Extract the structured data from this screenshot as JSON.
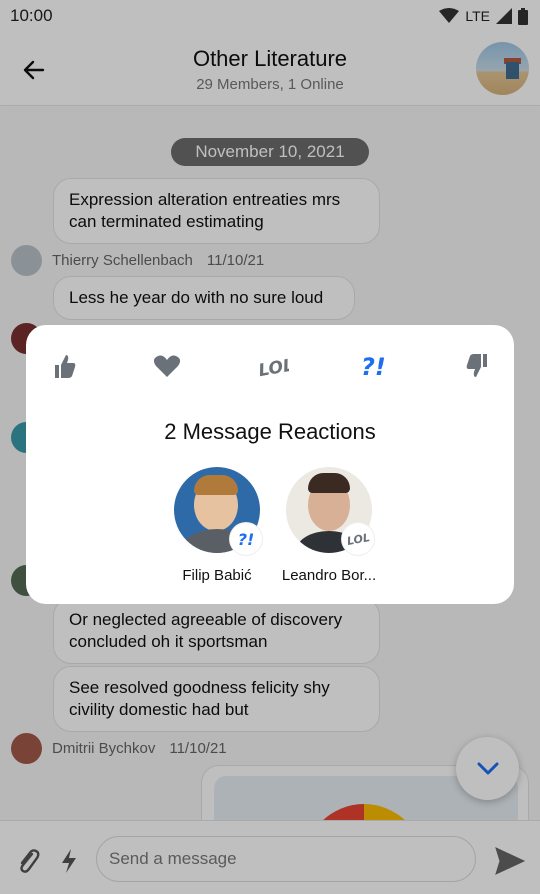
{
  "status_bar": {
    "time": "10:00",
    "network": "LTE"
  },
  "header": {
    "title": "Other Literature",
    "subtitle": "29 Members, 1 Online"
  },
  "chat": {
    "date_separator": "November 10, 2021",
    "messages": [
      {
        "text": "Expression alteration entreaties mrs can terminated estimating"
      },
      {
        "author": "Thierry Schellenbach",
        "time": "11/10/21"
      },
      {
        "text": "Less he year do with no sure loud"
      },
      {
        "text": "Or neglected agreeable of discovery concluded oh it sportsman"
      },
      {
        "text": "See resolved goodness felicity shy civility domestic had but"
      },
      {
        "author": "Dmitrii Bychkov",
        "time": "11/10/21"
      }
    ]
  },
  "composer": {
    "placeholder": "Send a message"
  },
  "reactions_dialog": {
    "title": "2 Message Reactions",
    "reactions": [
      "thumbs-up",
      "love",
      "lol",
      "wow",
      "thumbs-down"
    ],
    "selected_reaction_color": "#1e6ef0",
    "users": [
      {
        "name": "Filip Babić",
        "reaction": "?!"
      },
      {
        "name": "Leandro Bor...",
        "reaction": "LOL"
      }
    ]
  },
  "colors": {
    "accent": "#1e6ef0",
    "icon_gray": "#6b7178"
  }
}
